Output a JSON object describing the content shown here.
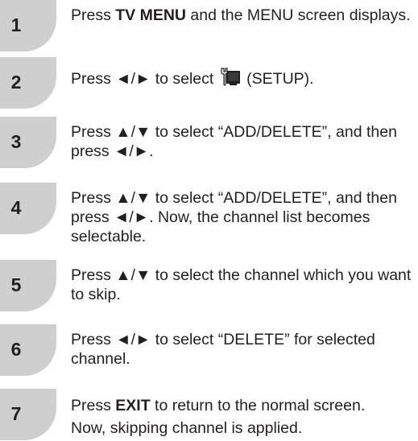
{
  "steps": [
    {
      "number": "1",
      "pre": "Press ",
      "bold": "TV MENU",
      "post": " and the MENU screen displays."
    },
    {
      "number": "2",
      "pre": "Press ◄/► to select ",
      "icon": "setup-icon",
      "post": " (SETUP)."
    },
    {
      "number": "3",
      "text": "Press ▲/▼ to select “ADD/DELETE”, and then press ◄/►."
    },
    {
      "number": "4",
      "text": "Press ▲/▼ to select “ADD/DELETE”, and then press ◄/►. Now, the channel list becomes selectable."
    },
    {
      "number": "5",
      "text": "Press ▲/▼ to select the channel which you want to skip."
    },
    {
      "number": "6",
      "text": "Press ◄/► to select “DELETE” for selected channel."
    },
    {
      "number": "7",
      "pre": "Press ",
      "bold": "EXIT",
      "post": " to return to the normal screen.",
      "line2": "Now, skipping channel is applied."
    }
  ]
}
